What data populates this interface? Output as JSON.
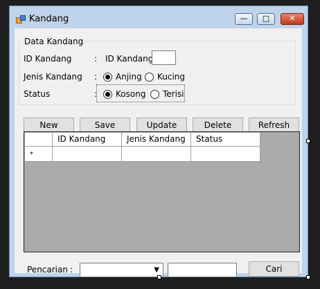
{
  "window": {
    "title": "Kandang",
    "min": "—",
    "max": "□",
    "close": "✕"
  },
  "group": {
    "legend": "Data Kandang",
    "id_label": "ID Kandang",
    "colon": ":",
    "id_inline_label": "ID Kandang",
    "id_value": "",
    "jenis_label": "Jenis Kandang",
    "jenis_options": [
      "Anjing",
      "Kucing"
    ],
    "jenis_selected": "Anjing",
    "status_label": "Status",
    "status_options": [
      "Kosong",
      "Terisi"
    ],
    "status_selected": "Kosong"
  },
  "buttons": {
    "new": "New",
    "save": "Save",
    "update": "Update",
    "delete": "Delete",
    "refresh": "Refresh"
  },
  "grid": {
    "columns": [
      "ID Kandang",
      "Jenis Kandang",
      "Status"
    ],
    "new_row_marker": "*"
  },
  "search": {
    "label": "Pencarian",
    "colon": ":",
    "combo_value": "",
    "text_value": "",
    "button": "Cari"
  }
}
